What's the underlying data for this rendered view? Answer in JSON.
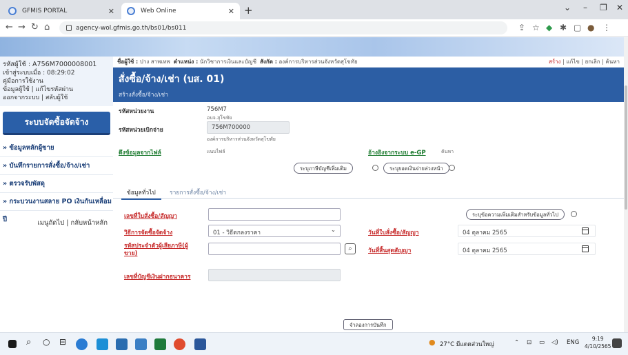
{
  "browser": {
    "tabs": [
      {
        "title": "GFMIS PORTAL"
      },
      {
        "title": "Web Online"
      }
    ],
    "new_tab": "+",
    "url": "agency-wol.gfmis.go.th/bs01/bs011"
  },
  "sidebar": {
    "user_id": "รหัสผู้ใช้ : A756M7000008001",
    "login_time": "เข้าสู่ระบบเมื่อ : 08:29:02",
    "manual": "คู่มือการใช้งาน",
    "account_links": "ข้อมูลผู้ใช้ | แก้ไขรหัสผ่าน",
    "logout_links": "ออกจากระบบ | สลับผู้ใช้",
    "system_title": "ระบบจัดซื้อจัดจ้าง",
    "menu": [
      "» ข้อมูลหลักผู้ขาย",
      "» บันทึกรายการสั่งซื้อ/จ้าง/เช่า",
      "» ตรวจรับพัสดุ",
      "» กระบวนงานสลาย PO เงินกันเหลื่อมปี"
    ],
    "bottom_links": "เมนูถัดไป | กลับหน้าหลัก"
  },
  "userbar": {
    "label_user": "ชื่อผู้ใช้ :",
    "user": "ปาง สาพเทพ",
    "label_pos": "ตำแหน่ง :",
    "position": "นักวิชาการเงินและบัญชี",
    "label_org": "สังกัด :",
    "org": "องค์การบริหารส่วนจังหวัดสุโขทัย",
    "actions": [
      "สร้าง",
      "แก้ไข",
      "ยกเลิก",
      "ค้นหา"
    ]
  },
  "header": {
    "title": "สั่งซื้อ/จ้าง/เช่า (บส. 01)",
    "subtitle": "สร้างสั่งซื้อ/จ้าง/เช่า"
  },
  "form": {
    "agency_code_label": "รหัสหน่วยงาน",
    "agency_code": "756M7",
    "agency_name": "อบจ.สุโขทัย",
    "disb_unit_label": "รหัสหน่วยเบิกจ่าย",
    "disb_unit": "756M700000",
    "disb_unit_name": "องค์การบริหารส่วนจังหวัดสุโขทัย",
    "pull_file_label": "ดึงข้อมูลจากไฟล์",
    "attach_file": "แนบไฟล์",
    "egp_label": "อ้างอิงจากระบบ e-GP",
    "search": "ค้นหา",
    "btn_more_accounts": "ระบุภาษีบัญชีเพิ่มเติม",
    "btn_prepaid": "ระบุยอดเงินจ่ายล่วงหน้า",
    "tabs": [
      "ข้อมูลทั่วไป",
      "รายการสั่งซื้อ/จ้าง/เช่า"
    ],
    "po_no_label": "เลขที่ใบสั่งซื้อ/สัญญา",
    "po_no": "",
    "btn_general_info": "ระบุข้อความเพิ่มเติมสำหรับข้อมูลทั่วไป",
    "method_label": "วิธีการจัดซื้อจัดจ้าง",
    "method_value": "01 - วิธีตกลงราคา",
    "po_date_label": "วันที่ใบสั่งซื้อ/สัญญา",
    "po_date": "04 ตุลาคม 2565",
    "vendor_label": "รหัสประจำตัวผู้เสียภาษี(ผู้ขาย)",
    "vendor_value": "",
    "end_date_label": "วันที่สิ้นสุดสัญญา",
    "end_date": "04 ตุลาคม 2565",
    "bank_label": "เลขที่บัญชีเงินฝากธนาคาร",
    "bank_value": "",
    "btn_simulate": "จำลองการบันทึก"
  },
  "taskbar": {
    "weather": "27°C มีแดดส่วนใหญ่",
    "lang": "ENG",
    "time": "9:19",
    "date": "4/10/2565"
  },
  "colors": {
    "header_blue": "#2c5ea4",
    "link_red": "#c62828",
    "link_green": "#1b7a2e",
    "menu_navy": "#1b3f78"
  }
}
